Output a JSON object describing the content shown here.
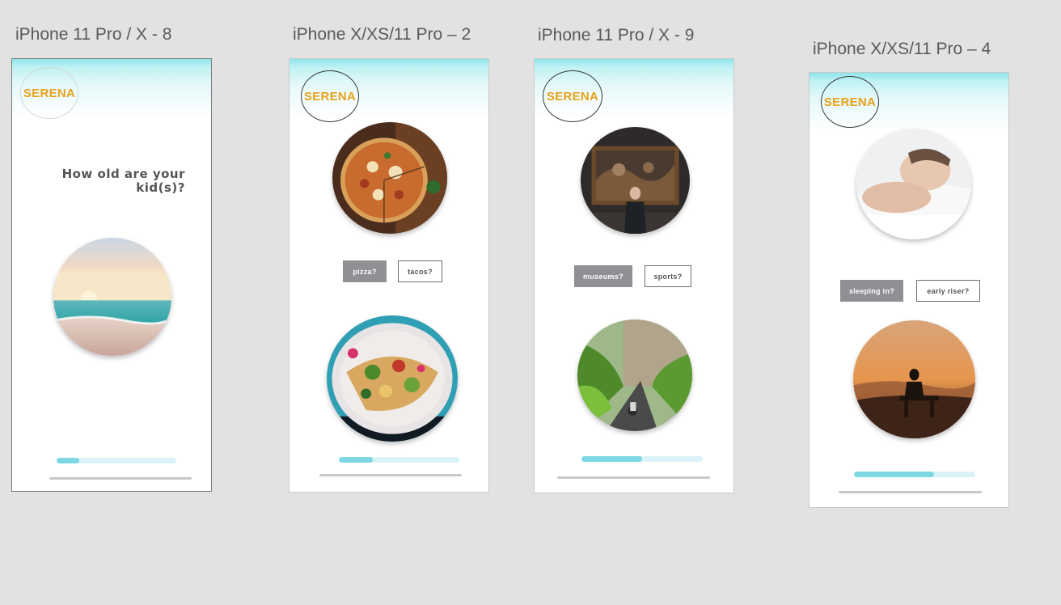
{
  "artboards": [
    {
      "title": "iPhone 11 Pro / X - 8",
      "logo": "SERENA",
      "question": "How old are your kid(s)?",
      "photo": "beach-sunset-photo",
      "progress": 0.19
    },
    {
      "title": "iPhone X/XS/11 Pro – 2",
      "logo": "SERENA",
      "photo_top": "pizza-photo",
      "photo_bottom": "tacos-photo",
      "options": [
        "pizza?",
        "tacos?"
      ],
      "progress": 0.28
    },
    {
      "title": "iPhone 11 Pro / X - 9",
      "logo": "SERENA",
      "photo_top": "museum-painting-photo",
      "photo_bottom": "cyclist-road-photo",
      "options": [
        "museums?",
        "sports?"
      ],
      "progress": 0.5
    },
    {
      "title": "iPhone X/XS/11 Pro – 4",
      "logo": "SERENA",
      "photo_top": "sleeping-man-photo",
      "photo_bottom": "sunrise-sitting-photo",
      "options": [
        "sleeping in?",
        "early riser?"
      ],
      "progress": 0.66
    }
  ],
  "colors": {
    "canvas_bg": "#e2e2e2",
    "logo_text": "#e8a21a",
    "gradient_top": "#8ee6ec",
    "active_button": "#8f8f94",
    "progress_fill": "#7dd8e2",
    "progress_track": "#d9f3f6"
  }
}
